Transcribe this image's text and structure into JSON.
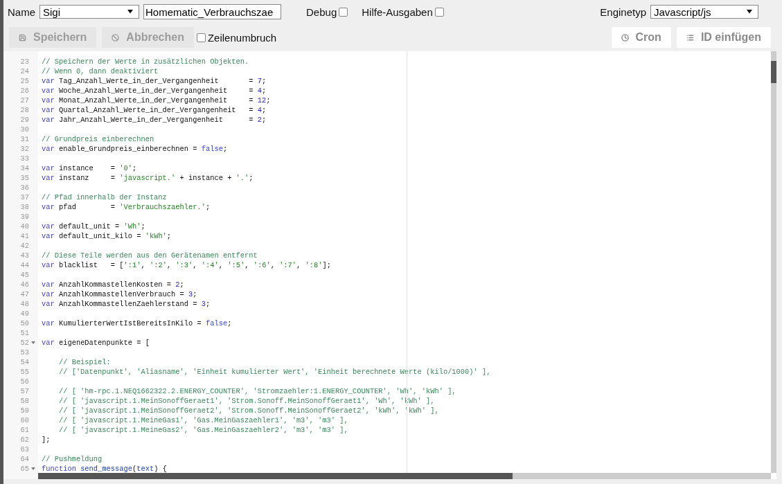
{
  "toolbar": {
    "name_label": "Name",
    "group_select": {
      "value": "Sigi"
    },
    "name_field": {
      "value": "Homematic_Verbrauchszae"
    },
    "options": [
      {
        "label": "Debug",
        "checked": false
      },
      {
        "label": "Hilfe-Ausgaben",
        "checked": false
      }
    ],
    "engine_label": "Enginetyp",
    "engine_select": {
      "value": "Javascript/js"
    }
  },
  "actions": [
    {
      "label": "Speichern",
      "kind": "save",
      "disabled": true
    },
    {
      "label": "Abbrechen",
      "kind": "cancel",
      "disabled": true
    }
  ],
  "wrap_option": {
    "label": "Zeilenumbruch",
    "checked": false
  },
  "right_actions": [
    {
      "label": "Cron",
      "kind": "clock",
      "disabled": false
    },
    {
      "label": "ID einfügen",
      "kind": "list",
      "disabled": false
    }
  ],
  "editor": {
    "lines": [
      {
        "number": "23",
        "fold": false,
        "tokens": [
          {
            "kind": "comment",
            "text": "// Speichern der Werte in zusätzlichen Objekten."
          }
        ]
      },
      {
        "number": "24",
        "fold": false,
        "tokens": [
          {
            "kind": "comment",
            "text": "// Wenn 0, dann deaktiviert"
          }
        ]
      },
      {
        "number": "25",
        "fold": false,
        "tokens": [
          {
            "kind": "keyword",
            "text": "var"
          },
          {
            "kind": "plain",
            "text": " Tag_Anzahl_Werte_in_der_Vergangenheit       = "
          },
          {
            "kind": "number",
            "text": "7"
          },
          {
            "kind": "plain",
            "text": ";"
          }
        ]
      },
      {
        "number": "26",
        "fold": false,
        "tokens": [
          {
            "kind": "keyword",
            "text": "var"
          },
          {
            "kind": "plain",
            "text": " Woche_Anzahl_Werte_in_der_Vergangenheit     = "
          },
          {
            "kind": "number",
            "text": "4"
          },
          {
            "kind": "plain",
            "text": ";"
          }
        ]
      },
      {
        "number": "27",
        "fold": false,
        "tokens": [
          {
            "kind": "keyword",
            "text": "var"
          },
          {
            "kind": "plain",
            "text": " Monat_Anzahl_Werte_in_der_Vergangenheit     = "
          },
          {
            "kind": "number",
            "text": "12"
          },
          {
            "kind": "plain",
            "text": ";"
          }
        ]
      },
      {
        "number": "28",
        "fold": false,
        "tokens": [
          {
            "kind": "keyword",
            "text": "var"
          },
          {
            "kind": "plain",
            "text": " Quartal_Anzahl_Werte_in_der_Vergangenheit   = "
          },
          {
            "kind": "number",
            "text": "4"
          },
          {
            "kind": "plain",
            "text": ";"
          }
        ]
      },
      {
        "number": "29",
        "fold": false,
        "tokens": [
          {
            "kind": "keyword",
            "text": "var"
          },
          {
            "kind": "plain",
            "text": " Jahr_Anzahl_Werte_in_der_Vergangenheit      = "
          },
          {
            "kind": "number",
            "text": "2"
          },
          {
            "kind": "plain",
            "text": ";"
          }
        ]
      },
      {
        "number": "30",
        "fold": false
      },
      {
        "number": "31",
        "fold": false,
        "tokens": [
          {
            "kind": "comment",
            "text": "// Grundpreis einberechnen"
          }
        ]
      },
      {
        "number": "32",
        "fold": false,
        "tokens": [
          {
            "kind": "keyword",
            "text": "var"
          },
          {
            "kind": "plain",
            "text": " enable_Grundpreis_einberechnen = "
          },
          {
            "kind": "atom",
            "text": "false"
          },
          {
            "kind": "plain",
            "text": ";"
          }
        ]
      },
      {
        "number": "33",
        "fold": false
      },
      {
        "number": "34",
        "fold": false,
        "tokens": [
          {
            "kind": "keyword",
            "text": "var"
          },
          {
            "kind": "plain",
            "text": " instance    = "
          },
          {
            "kind": "string",
            "text": "'0'"
          },
          {
            "kind": "plain",
            "text": ";"
          }
        ]
      },
      {
        "number": "35",
        "fold": false,
        "tokens": [
          {
            "kind": "keyword",
            "text": "var"
          },
          {
            "kind": "plain",
            "text": " instanz     = "
          },
          {
            "kind": "string",
            "text": "'javascript.'"
          },
          {
            "kind": "plain",
            "text": " + instance + "
          },
          {
            "kind": "string",
            "text": "'.'"
          },
          {
            "kind": "plain",
            "text": ";"
          }
        ]
      },
      {
        "number": "36",
        "fold": false
      },
      {
        "number": "37",
        "fold": false,
        "tokens": [
          {
            "kind": "comment",
            "text": "// Pfad innerhalb der Instanz"
          }
        ]
      },
      {
        "number": "38",
        "fold": false,
        "tokens": [
          {
            "kind": "keyword",
            "text": "var"
          },
          {
            "kind": "plain",
            "text": " pfad        = "
          },
          {
            "kind": "string",
            "text": "'Verbrauchszaehler.'"
          },
          {
            "kind": "plain",
            "text": ";"
          }
        ]
      },
      {
        "number": "39",
        "fold": false
      },
      {
        "number": "40",
        "fold": false,
        "tokens": [
          {
            "kind": "keyword",
            "text": "var"
          },
          {
            "kind": "plain",
            "text": " default_unit = "
          },
          {
            "kind": "string",
            "text": "'Wh'"
          },
          {
            "kind": "plain",
            "text": ";"
          }
        ]
      },
      {
        "number": "41",
        "fold": false,
        "tokens": [
          {
            "kind": "keyword",
            "text": "var"
          },
          {
            "kind": "plain",
            "text": " default_unit_kilo = "
          },
          {
            "kind": "string",
            "text": "'kWh'"
          },
          {
            "kind": "plain",
            "text": ";"
          }
        ]
      },
      {
        "number": "42",
        "fold": false
      },
      {
        "number": "43",
        "fold": false,
        "tokens": [
          {
            "kind": "comment",
            "text": "// Diese Teile werden aus den Gerätenamen entfernt"
          }
        ]
      },
      {
        "number": "44",
        "fold": false,
        "tokens": [
          {
            "kind": "keyword",
            "text": "var"
          },
          {
            "kind": "plain",
            "text": " blacklist   = ["
          },
          {
            "kind": "string",
            "text": "':1'"
          },
          {
            "kind": "plain",
            "text": ", "
          },
          {
            "kind": "string",
            "text": "':2'"
          },
          {
            "kind": "plain",
            "text": ", "
          },
          {
            "kind": "string",
            "text": "':3'"
          },
          {
            "kind": "plain",
            "text": ", "
          },
          {
            "kind": "string",
            "text": "':4'"
          },
          {
            "kind": "plain",
            "text": ", "
          },
          {
            "kind": "string",
            "text": "':5'"
          },
          {
            "kind": "plain",
            "text": ", "
          },
          {
            "kind": "string",
            "text": "':6'"
          },
          {
            "kind": "plain",
            "text": ", "
          },
          {
            "kind": "string",
            "text": "':7'"
          },
          {
            "kind": "plain",
            "text": ", "
          },
          {
            "kind": "string",
            "text": "':8'"
          },
          {
            "kind": "plain",
            "text": "];"
          }
        ]
      },
      {
        "number": "45",
        "fold": false
      },
      {
        "number": "46",
        "fold": false,
        "tokens": [
          {
            "kind": "keyword",
            "text": "var"
          },
          {
            "kind": "plain",
            "text": " AnzahlKommastellenKosten = "
          },
          {
            "kind": "number",
            "text": "2"
          },
          {
            "kind": "plain",
            "text": ";"
          }
        ]
      },
      {
        "number": "47",
        "fold": false,
        "tokens": [
          {
            "kind": "keyword",
            "text": "var"
          },
          {
            "kind": "plain",
            "text": " AnzahlKommastellenVerbrauch = "
          },
          {
            "kind": "number",
            "text": "3"
          },
          {
            "kind": "plain",
            "text": ";"
          }
        ]
      },
      {
        "number": "48",
        "fold": false,
        "tokens": [
          {
            "kind": "keyword",
            "text": "var"
          },
          {
            "kind": "plain",
            "text": " AnzahlKommastellenZaehlerstand = "
          },
          {
            "kind": "number",
            "text": "3"
          },
          {
            "kind": "plain",
            "text": ";"
          }
        ]
      },
      {
        "number": "49",
        "fold": false
      },
      {
        "number": "50",
        "fold": false,
        "tokens": [
          {
            "kind": "keyword",
            "text": "var"
          },
          {
            "kind": "plain",
            "text": " KumulierterWertIstBereitsInKilo = "
          },
          {
            "kind": "atom",
            "text": "false"
          },
          {
            "kind": "plain",
            "text": ";"
          }
        ]
      },
      {
        "number": "51",
        "fold": false
      },
      {
        "number": "52",
        "fold": true,
        "tokens": [
          {
            "kind": "keyword",
            "text": "var"
          },
          {
            "kind": "plain",
            "text": " eigeneDatenpunkte = ["
          }
        ]
      },
      {
        "number": "53",
        "fold": false
      },
      {
        "number": "54",
        "fold": false,
        "tokens": [
          {
            "kind": "comment",
            "text": "    // Beispiel:"
          }
        ]
      },
      {
        "number": "55",
        "fold": false,
        "tokens": [
          {
            "kind": "comment",
            "text": "    // ['Datenpunkt', 'Aliasname', 'Einheit kumulierter Wert', 'Einheit berechnete Werte (kilo/1000)' ],"
          }
        ]
      },
      {
        "number": "56",
        "fold": false
      },
      {
        "number": "57",
        "fold": false,
        "tokens": [
          {
            "kind": "comment",
            "text": "    // [ 'hm-rpc.1.NEQ1662322.2.ENERGY_COUNTER', 'Stromzaehler:1.ENERGY_COUNTER', 'Wh', 'kWh' ],"
          }
        ]
      },
      {
        "number": "58",
        "fold": false,
        "tokens": [
          {
            "kind": "comment",
            "text": "    // [ 'javascript.1.MeinSonoffGeraet1', 'Strom.Sonoff.MeinSonoffGeraet1', 'Wh', 'kWh' ],"
          }
        ]
      },
      {
        "number": "59",
        "fold": false,
        "tokens": [
          {
            "kind": "comment",
            "text": "    // [ 'javascript.1.MeinSonoffGeraet2', 'Strom.Sonoff.MeinSonoffGeraet2', 'kWh', 'kWh' ],"
          }
        ]
      },
      {
        "number": "60",
        "fold": false,
        "tokens": [
          {
            "kind": "comment",
            "text": "    // [ 'javascript.1.MeineGas1', 'Gas.MeinGaszaehler1', 'm3', 'm3' ],"
          }
        ]
      },
      {
        "number": "61",
        "fold": false,
        "tokens": [
          {
            "kind": "comment",
            "text": "    // [ 'javascript.1.MeineGas2', 'Gas.MeinGaszaehler2', 'm3', 'm3' ],"
          }
        ]
      },
      {
        "number": "62",
        "fold": false,
        "tokens": [
          {
            "kind": "plain",
            "text": "];"
          }
        ]
      },
      {
        "number": "63",
        "fold": false
      },
      {
        "number": "64",
        "fold": false,
        "tokens": [
          {
            "kind": "comment",
            "text": "// Pushmeldung"
          }
        ]
      },
      {
        "number": "65",
        "fold": true,
        "tokens": [
          {
            "kind": "keyword",
            "text": "function"
          },
          {
            "kind": "def",
            "text": " send_message"
          },
          {
            "kind": "plain",
            "text": "("
          },
          {
            "kind": "def",
            "text": "text"
          },
          {
            "kind": "plain",
            "text": ") {"
          }
        ]
      }
    ]
  }
}
